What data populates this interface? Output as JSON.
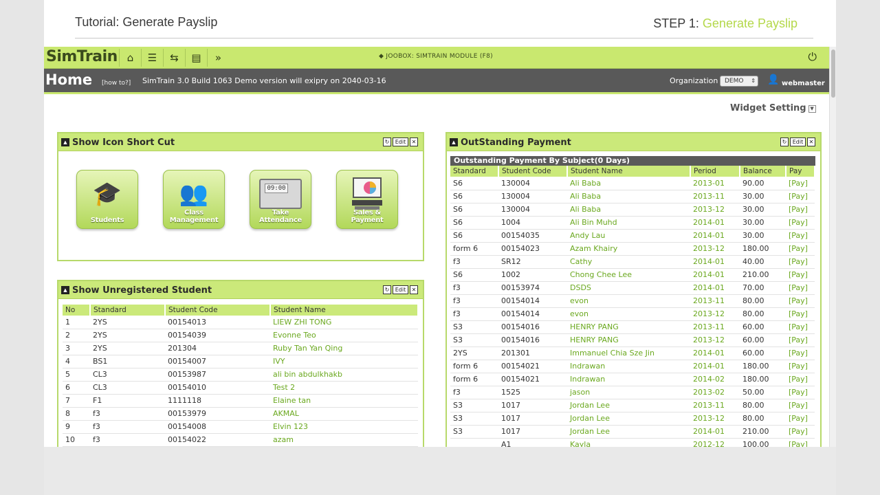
{
  "tutorial": {
    "title": "Tutorial: Generate Payslip",
    "step_prefix": "STEP 1:",
    "step_highlight": "Generate Payslip"
  },
  "topbar": {
    "logo": "SimTrain",
    "module_label": "JOOBOX: SIMTRAIN MODULE (F8)",
    "icons": [
      "home-icon",
      "layers-icon",
      "swap-icon",
      "document-icon",
      "forward-icon",
      "power-icon"
    ]
  },
  "homebar": {
    "title": "Home",
    "howto": "[how to?]",
    "build_info": "SimTrain 3.0 Build 1063 Demo version will exipry on 2040-03-16",
    "org_label": "Organization",
    "org_value": "DEMO",
    "user": "webmaster"
  },
  "widget_setting": "Widget Setting",
  "controls": {
    "refresh": "↻",
    "edit": "Edit",
    "close": "✕",
    "collapse": "▲"
  },
  "shortcut_panel": {
    "title": "Show Icon Short Cut",
    "items": [
      {
        "label": "Students",
        "icon": "student-icon"
      },
      {
        "label": "Class Management",
        "icon": "class-icon"
      },
      {
        "label": "Take Attendance",
        "icon": "attendance-icon",
        "clock": "09:00"
      },
      {
        "label": "Sales & Payment",
        "icon": "sales-icon"
      }
    ]
  },
  "unreg_panel": {
    "title": "Show Unregistered Student",
    "columns": [
      "No",
      "Standard",
      "Student Code",
      "Student Name"
    ],
    "rows": [
      [
        "1",
        "2YS",
        "00154013",
        "LIEW ZHI TONG"
      ],
      [
        "2",
        "2YS",
        "00154039",
        "Evonne Teo"
      ],
      [
        "3",
        "2YS",
        "201304",
        "Ruby Tan Yan Qing"
      ],
      [
        "4",
        "BS1",
        "00154007",
        "IVY"
      ],
      [
        "5",
        "CL3",
        "00153987",
        "ali bin abdulkhakb"
      ],
      [
        "6",
        "CL3",
        "00154010",
        "Test 2"
      ],
      [
        "7",
        "F1",
        "1111118",
        "Elaine tan"
      ],
      [
        "8",
        "f3",
        "00153979",
        "AKMAL"
      ],
      [
        "9",
        "f3",
        "00154008",
        "Elvin 123"
      ],
      [
        "10",
        "f3",
        "00154022",
        "azam"
      ]
    ]
  },
  "outstanding_panel": {
    "title": "OutStanding Payment",
    "subtitle": "Outstanding Payment By Subject(0 Days)",
    "columns": [
      "Standard",
      "Student Code",
      "Student Name",
      "Period",
      "Balance",
      "Pay"
    ],
    "rows": [
      [
        "S6",
        "130004",
        "Ali Baba",
        "2013-01",
        "90.00",
        "[Pay]"
      ],
      [
        "S6",
        "130004",
        "Ali Baba",
        "2013-11",
        "30.00",
        "[Pay]"
      ],
      [
        "S6",
        "130004",
        "Ali Baba",
        "2013-12",
        "30.00",
        "[Pay]"
      ],
      [
        "S6",
        "1004",
        "Ali Bin Muhd",
        "2014-01",
        "30.00",
        "[Pay]"
      ],
      [
        "S6",
        "00154035",
        "Andy Lau",
        "2014-01",
        "30.00",
        "[Pay]"
      ],
      [
        "form 6",
        "00154023",
        "Azam Khairy",
        "2013-12",
        "180.00",
        "[Pay]"
      ],
      [
        "f3",
        "SR12",
        "Cathy",
        "2014-01",
        "40.00",
        "[Pay]"
      ],
      [
        "S6",
        "1002",
        "Chong Chee Lee",
        "2014-01",
        "210.00",
        "[Pay]"
      ],
      [
        "f3",
        "00153974",
        "DSDS",
        "2014-01",
        "70.00",
        "[Pay]"
      ],
      [
        "f3",
        "00154014",
        "evon",
        "2013-11",
        "80.00",
        "[Pay]"
      ],
      [
        "f3",
        "00154014",
        "evon",
        "2013-12",
        "80.00",
        "[Pay]"
      ],
      [
        "S3",
        "00154016",
        "HENRY PANG",
        "2013-11",
        "60.00",
        "[Pay]"
      ],
      [
        "S3",
        "00154016",
        "HENRY PANG",
        "2013-12",
        "60.00",
        "[Pay]"
      ],
      [
        "2YS",
        "201301",
        "Immanuel Chia Sze Jin",
        "2014-01",
        "60.00",
        "[Pay]"
      ],
      [
        "form 6",
        "00154021",
        "Indrawan",
        "2014-01",
        "180.00",
        "[Pay]"
      ],
      [
        "form 6",
        "00154021",
        "Indrawan",
        "2014-02",
        "180.00",
        "[Pay]"
      ],
      [
        "f3",
        "1525",
        "jason",
        "2013-02",
        "50.00",
        "[Pay]"
      ],
      [
        "S3",
        "1017",
        "Jordan Lee",
        "2013-11",
        "80.00",
        "[Pay]"
      ],
      [
        "S3",
        "1017",
        "Jordan Lee",
        "2013-12",
        "80.00",
        "[Pay]"
      ],
      [
        "S3",
        "1017",
        "Jordan Lee",
        "2014-01",
        "210.00",
        "[Pay]"
      ],
      [
        "",
        "A1",
        "Kayla",
        "2012-12",
        "100.00",
        "[Pay]"
      ]
    ]
  }
}
